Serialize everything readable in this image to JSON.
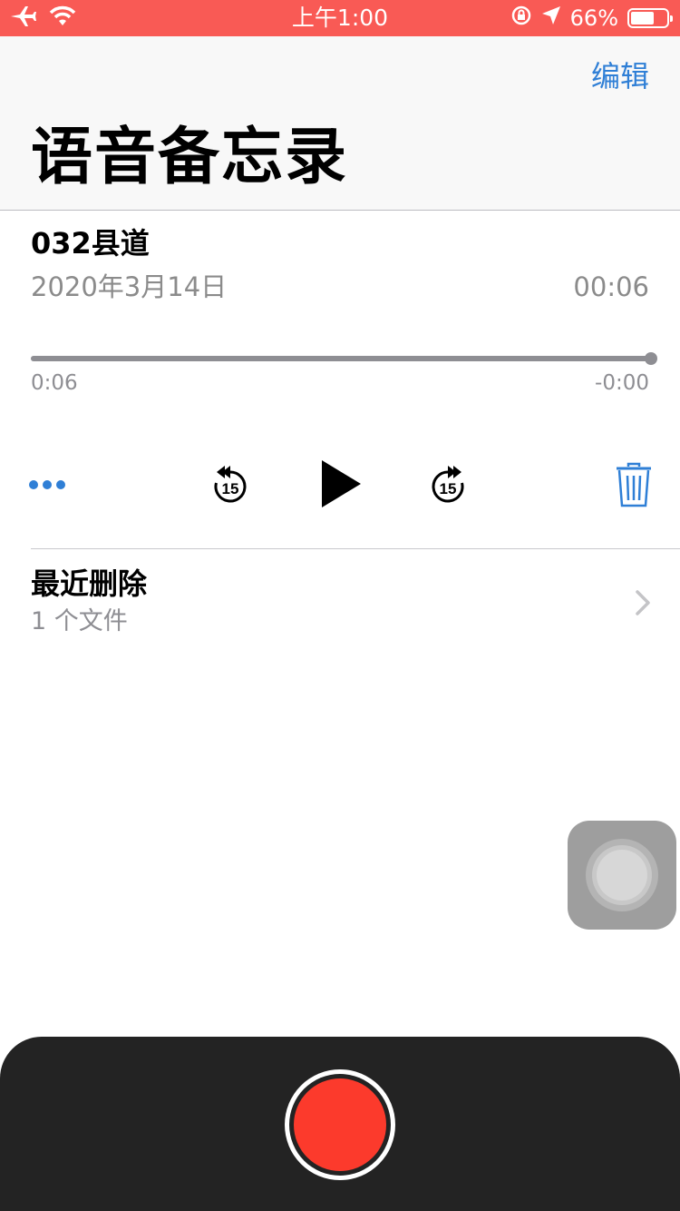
{
  "status_bar": {
    "time": "上午1:00",
    "battery_percent": "66%",
    "battery_level": 0.66,
    "icons": [
      "airplane-icon",
      "wifi-icon",
      "rotation-lock-icon",
      "location-icon",
      "battery-icon"
    ]
  },
  "header": {
    "edit_label": "编辑",
    "title": "语音备忘录"
  },
  "recording": {
    "title": "032县道",
    "date": "2020年3月14日",
    "duration": "00:06",
    "elapsed": "0:06",
    "remaining": "-0:00",
    "progress": 1.0
  },
  "controls": {
    "rewind_seconds": "15",
    "forward_seconds": "15"
  },
  "recently_deleted": {
    "title": "最近删除",
    "count": "1 个文件"
  },
  "colors": {
    "status_bar": "#f95a55",
    "accent_blue": "#2f7fd6",
    "record_red": "#fc3a2c",
    "record_bar": "#232323"
  }
}
